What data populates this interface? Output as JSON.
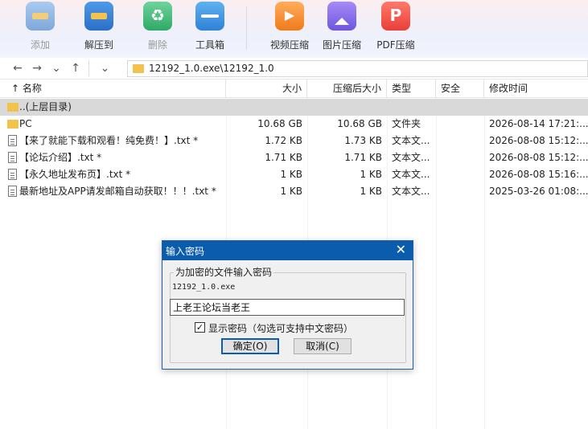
{
  "toolbar": {
    "buttons": [
      {
        "label": "添加",
        "icon": "add-archive-icon",
        "disabled": true
      },
      {
        "label": "解压到",
        "icon": "extract-icon",
        "disabled": false
      },
      {
        "label": "删除",
        "icon": "recycle-icon",
        "disabled": true
      },
      {
        "label": "工具箱",
        "icon": "toolbox-icon",
        "disabled": false
      },
      {
        "label": "视频压缩",
        "icon": "video-compress-icon",
        "disabled": false
      },
      {
        "label": "图片压缩",
        "icon": "image-compress-icon",
        "disabled": false
      },
      {
        "label": "PDF压缩",
        "icon": "pdf-compress-icon",
        "disabled": false
      }
    ]
  },
  "address": {
    "path": "12192_1.0.exe\\12192_1.0",
    "back": "←",
    "forward": "→",
    "history": "⌄",
    "up": "↑",
    "dropdown": "⌄"
  },
  "columns": {
    "name": "↑ 名称",
    "size": "大小",
    "packed": "压缩后大小",
    "type": "类型",
    "security": "安全",
    "modified": "修改时间"
  },
  "rows": [
    {
      "name": "..(上层目录)",
      "size": "",
      "packed": "",
      "type": "",
      "modified": "",
      "kind": "folder",
      "selected": true
    },
    {
      "name": "PC",
      "size": "10.68 GB",
      "packed": "10.68 GB",
      "type": "文件夹",
      "modified": "2026-08-14 17:21:...",
      "kind": "folder",
      "selected": false
    },
    {
      "name": "【来了就能下载和观看！纯免费！】.txt *",
      "size": "1.72 KB",
      "packed": "1.73 KB",
      "type": "文本文...",
      "modified": "2026-08-08 15:12:...",
      "kind": "txt",
      "selected": false
    },
    {
      "name": "【论坛介绍】.txt *",
      "size": "1.71 KB",
      "packed": "1.71 KB",
      "type": "文本文...",
      "modified": "2026-08-08 15:12:...",
      "kind": "txt",
      "selected": false
    },
    {
      "name": "【永久地址发布页】.txt *",
      "size": "1 KB",
      "packed": "1 KB",
      "type": "文本文...",
      "modified": "2026-08-08 15:16:...",
      "kind": "txt",
      "selected": false
    },
    {
      "name": "最新地址及APP请发邮箱自动获取！！！.txt *",
      "size": "1 KB",
      "packed": "1 KB",
      "type": "文本文...",
      "modified": "2025-03-26 01:08:...",
      "kind": "txt",
      "selected": false
    }
  ],
  "dialog": {
    "title": "输入密码",
    "close": "✕",
    "group_label": "为加密的文件输入密码",
    "filename": "12192_1.0.exe",
    "password_value": "上老王论坛当老王",
    "show_password_checked": true,
    "check_mark": "✓",
    "show_password_label": "显示密码（勾选可支持中文密码）",
    "ok_label": "确定(O)",
    "cancel_label": "取消(C)"
  }
}
